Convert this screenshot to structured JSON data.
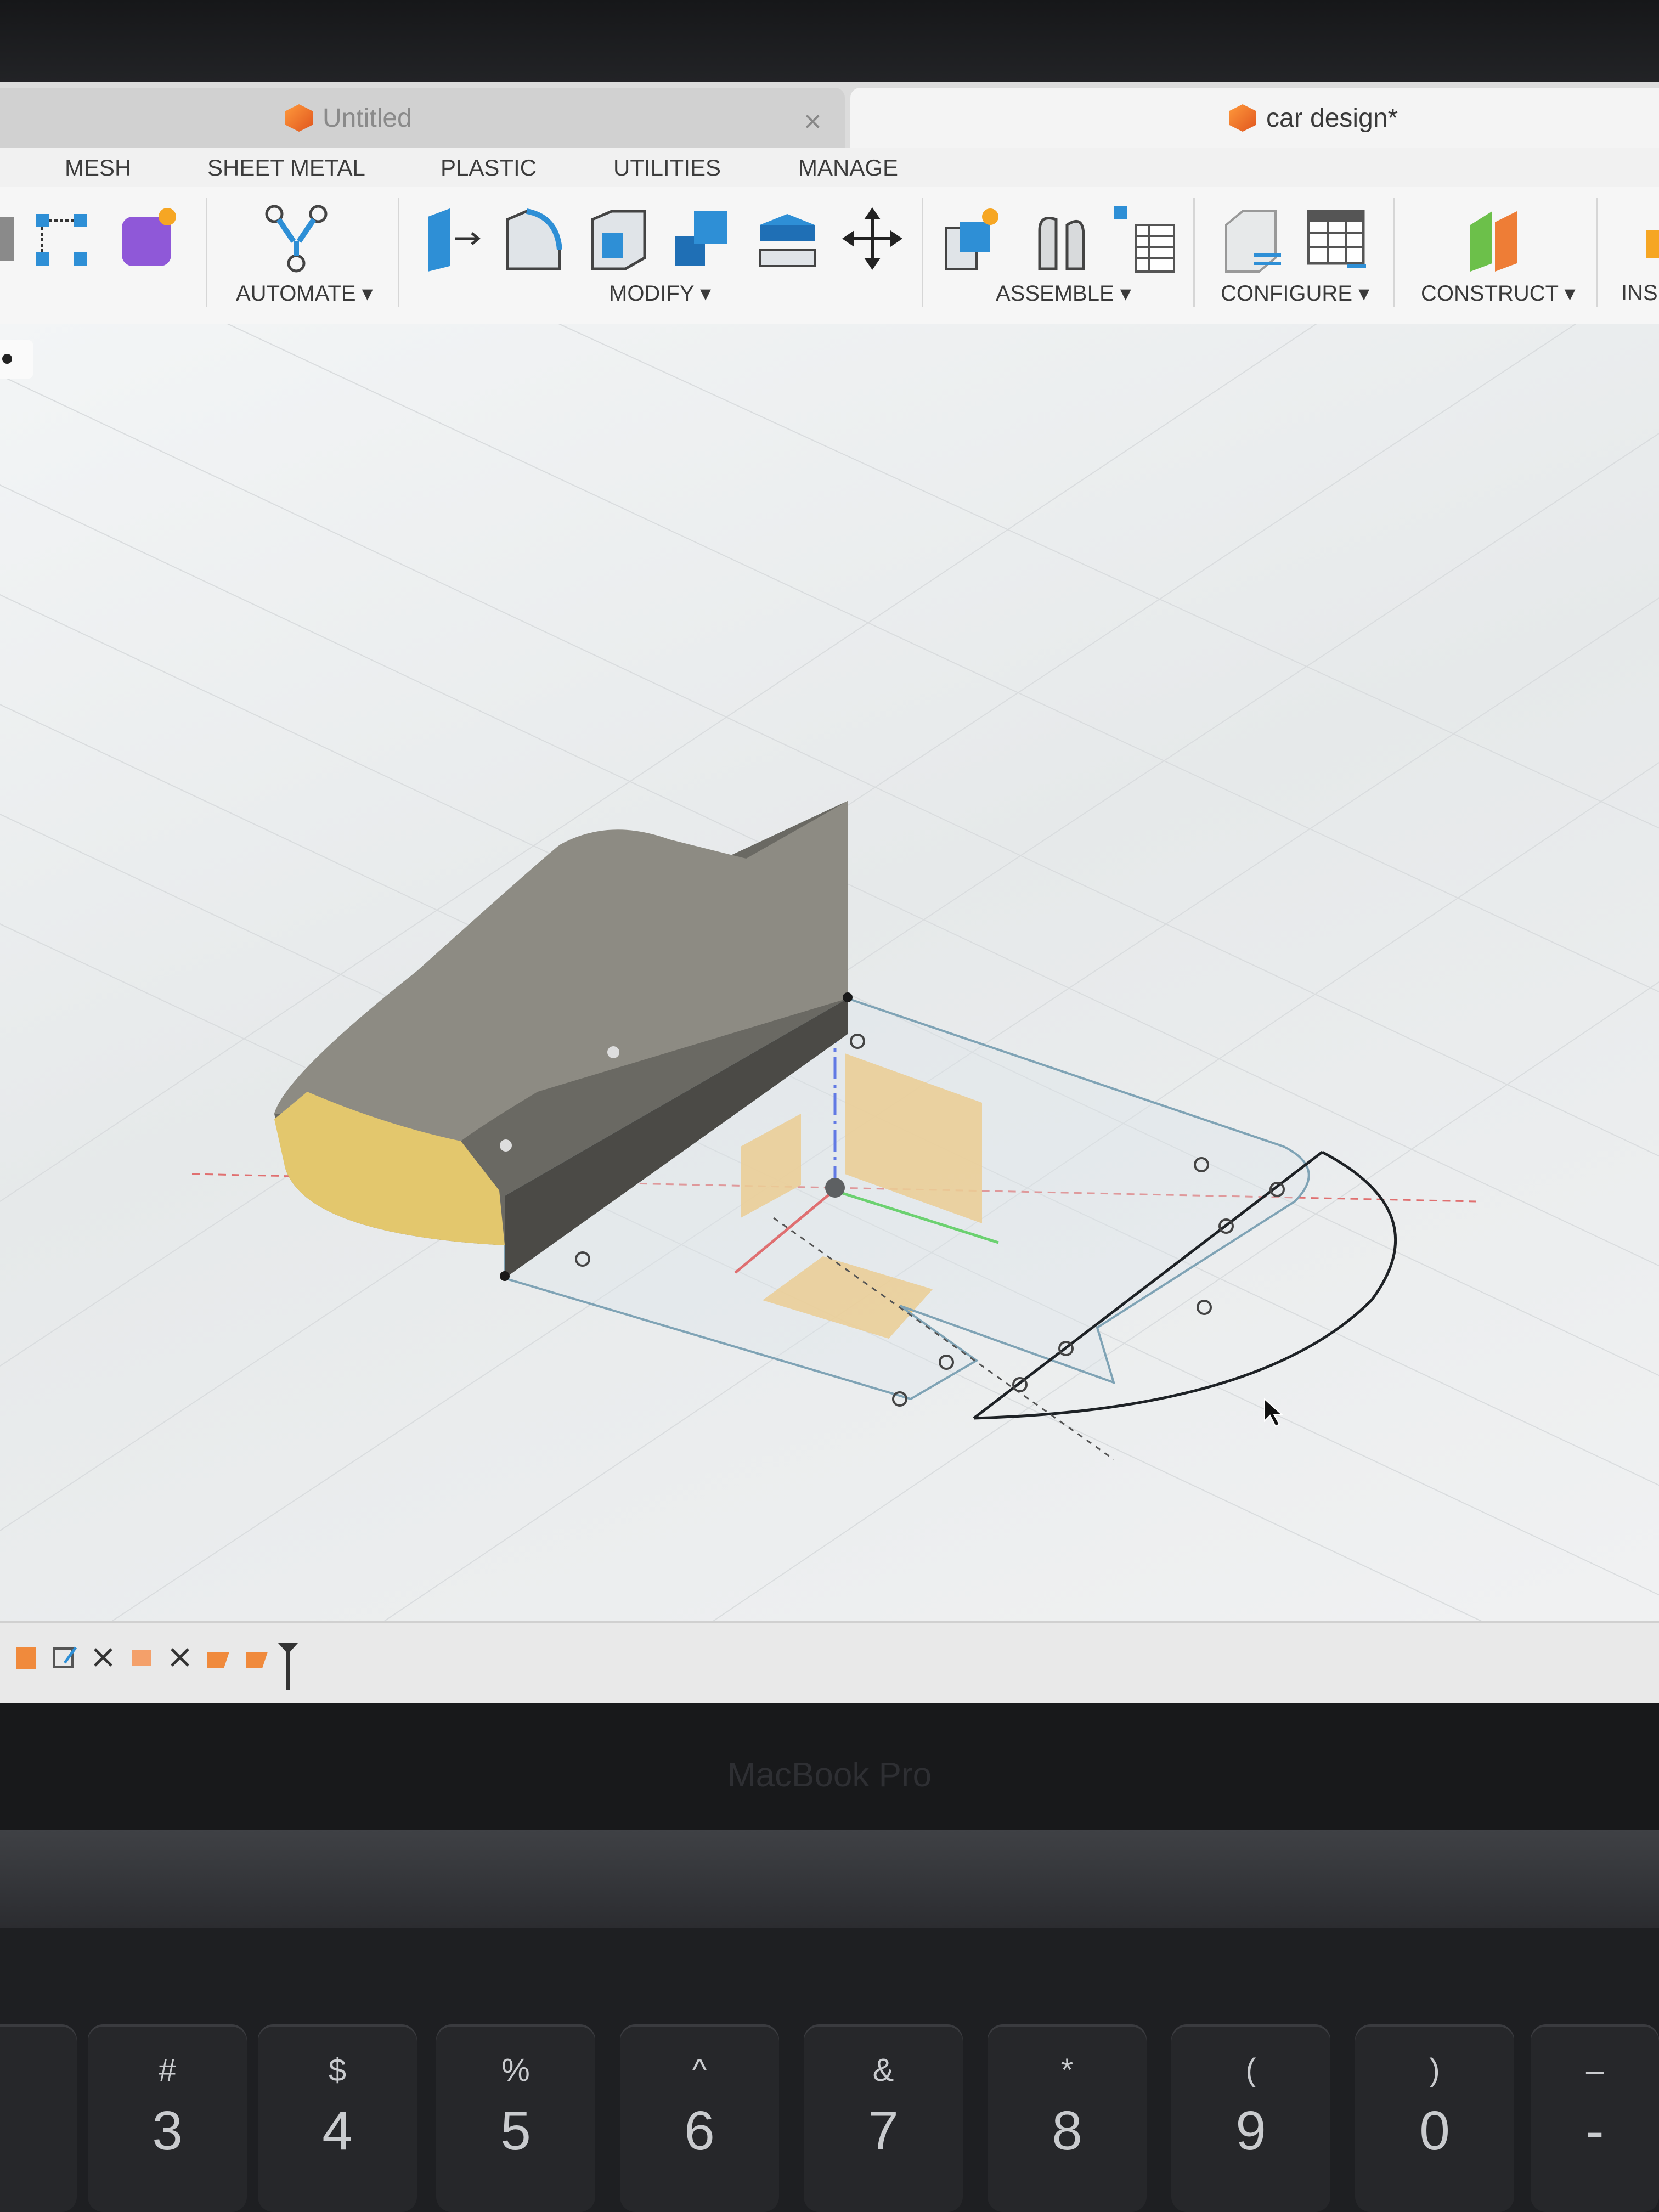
{
  "tabs": {
    "untitled": "Untitled",
    "active": "car design*"
  },
  "menus": [
    "MESH",
    "SHEET METAL",
    "PLASTIC",
    "UTILITIES",
    "MANAGE"
  ],
  "toolbar": {
    "automate": "AUTOMATE ▾",
    "modify": "MODIFY ▾",
    "assemble": "ASSEMBLE ▾",
    "configure": "CONFIGURE ▾",
    "construct": "CONSTRUCT ▾",
    "insert": "INSE"
  },
  "laptop": {
    "brand": "MacBook Pro"
  },
  "keys": [
    {
      "shift": "#",
      "main": "3"
    },
    {
      "shift": "$",
      "main": "4"
    },
    {
      "shift": "%",
      "main": "5"
    },
    {
      "shift": "^",
      "main": "6"
    },
    {
      "shift": "&",
      "main": "7"
    },
    {
      "shift": "*",
      "main": "8"
    },
    {
      "shift": "(",
      "main": "9"
    },
    {
      "shift": ")",
      "main": "0"
    },
    {
      "shift": "–",
      "main": "-"
    }
  ],
  "colors": {
    "accent_orange": "#f0a23a",
    "tool_blue": "#2e8fd6",
    "sketch_line": "#7fa3b5",
    "body_gray": "#5e5d57",
    "body_face": "#d9c47a"
  }
}
